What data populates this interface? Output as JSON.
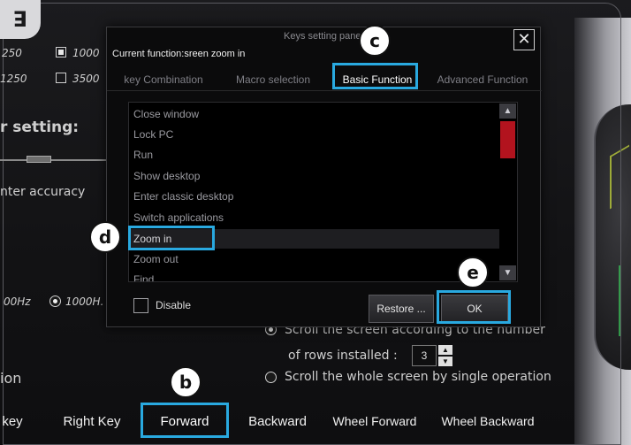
{
  "logo": {
    "glyph": "ꓱ"
  },
  "background": {
    "dpi_row1": {
      "left": "250",
      "right": "1000"
    },
    "dpi_row2": {
      "left": "1250",
      "right": "3500"
    },
    "setting_heading": "r setting:",
    "accuracy_label": "nter accuracy",
    "polling": {
      "left": "00Hz",
      "right": "1000H."
    },
    "scroll_option_1": "Scroll the screen according to the  number",
    "rows_label": "of rows installed :",
    "rows_value": "3",
    "scroll_option_2": "Scroll the whole screen by single operation",
    "section_label": "ion"
  },
  "bottom_tabs": [
    {
      "label": "key"
    },
    {
      "label": "Right Key"
    },
    {
      "label": "Forward",
      "active": true
    },
    {
      "label": "Backward"
    },
    {
      "label": "Wheel Forward"
    },
    {
      "label": "Wheel Backward"
    }
  ],
  "dialog": {
    "title": "Keys setting panel",
    "close_glyph": "✕",
    "current_function": "Current function:sreen zoom in",
    "tabs": [
      {
        "label": "key Combination"
      },
      {
        "label": "Macro selection"
      },
      {
        "label": "Basic Function",
        "active": true
      },
      {
        "label": "Advanced Function"
      }
    ],
    "list_items": [
      "Close window",
      "Lock PC",
      "Run",
      "Show desktop",
      "Enter classic desktop",
      "Switch applications",
      "Zoom in",
      "Zoom out",
      "Find"
    ],
    "selected_item": "Zoom in",
    "disable_label": "Disable",
    "restore_label": "Restore ...",
    "ok_label": "OK"
  },
  "callouts": {
    "b": "b",
    "c": "c",
    "d": "d",
    "e": "e"
  },
  "colors": {
    "highlight": "#29a9e0",
    "active_tab": "#b5141c",
    "scroll_thumb": "#b2131e"
  }
}
